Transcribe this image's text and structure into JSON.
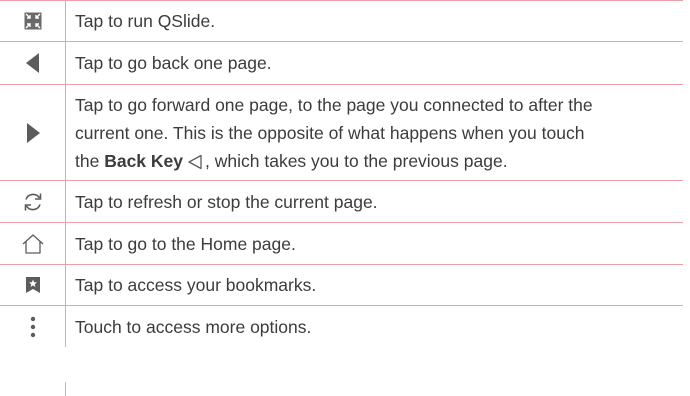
{
  "rows": [
    {
      "icon": "qslide-icon",
      "text": "Tap to run QSlide."
    },
    {
      "icon": "back-arrow-icon",
      "text": "Tap to go back one page."
    },
    {
      "icon": "forward-arrow-icon",
      "line1": "Tap to go forward one page, to the page you connected to after the",
      "line2": "current one. This is the opposite of what happens when you touch",
      "line3_prefix": "the ",
      "bold_text": "Back Key",
      "line3_suffix": ", which takes you to the previous page."
    },
    {
      "icon": "refresh-icon",
      "text": "Tap to refresh or stop the current page."
    },
    {
      "icon": "home-icon",
      "text": "Tap to go to the Home page."
    },
    {
      "icon": "bookmark-icon",
      "text": "Tap to access your bookmarks."
    },
    {
      "icon": "more-options-icon",
      "text": "Touch to access more options."
    }
  ],
  "colors": {
    "border": "#e9a0a8",
    "icon": "#5a5a5a",
    "text": "#3c3c3c"
  }
}
